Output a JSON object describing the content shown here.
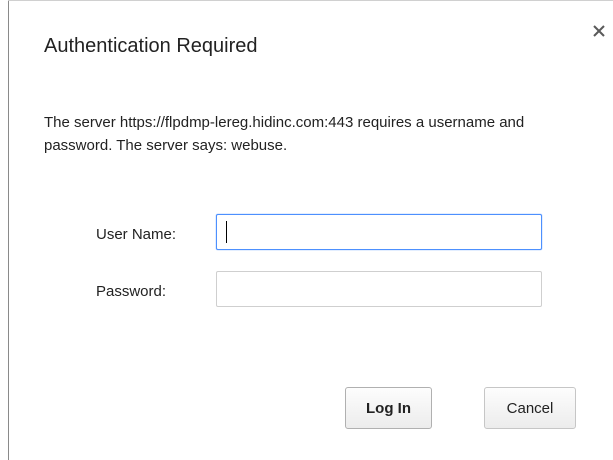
{
  "dialog": {
    "title": "Authentication Required",
    "close_icon": "close-icon",
    "message": "The server https://flpdmp-lereg.hidinc.com:443 requires a username and password. The server says: webuse.",
    "fields": {
      "username_label": "User Name:",
      "username_value": "",
      "password_label": "Password:",
      "password_value": ""
    },
    "buttons": {
      "login_label": "Log In",
      "cancel_label": "Cancel"
    }
  },
  "colors": {
    "focus_border": "#4d90fe",
    "input_border": "#cfcfcf",
    "text": "#222222"
  }
}
